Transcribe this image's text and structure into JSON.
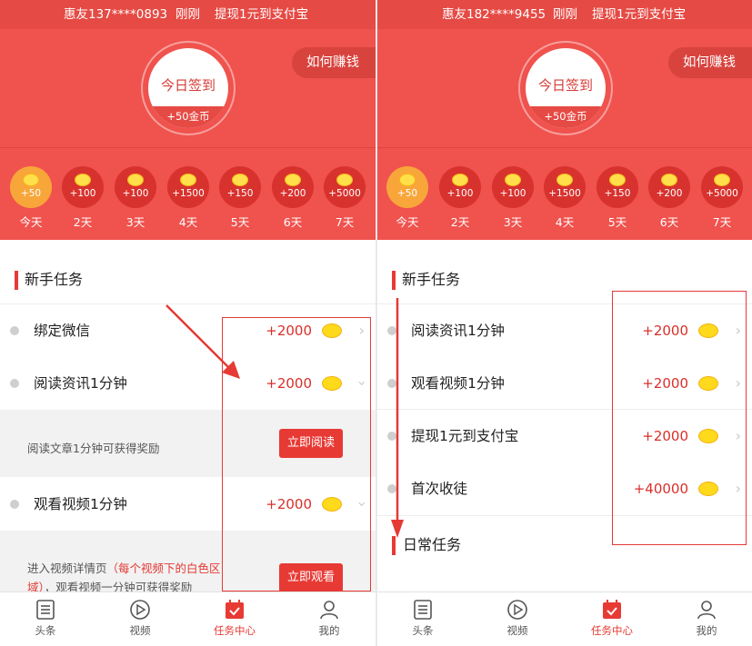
{
  "left": {
    "banner": {
      "user": "惠友137****0893",
      "time": "刚刚",
      "message": "提现1元到支付宝"
    },
    "checkin": {
      "title": "今日签到",
      "reward": "+50金币"
    },
    "earn_button": "如何赚钱",
    "days": [
      {
        "amount": "+50",
        "label": "今天"
      },
      {
        "amount": "+100",
        "label": "2天"
      },
      {
        "amount": "+100",
        "label": "3天"
      },
      {
        "amount": "+1500",
        "label": "4天"
      },
      {
        "amount": "+150",
        "label": "5天"
      },
      {
        "amount": "+200",
        "label": "6天"
      },
      {
        "amount": "+5000",
        "label": "7天"
      }
    ],
    "section_title": "新手任务",
    "tasks": [
      {
        "name": "绑定微信",
        "reward": "+2000"
      },
      {
        "name": "阅读资讯1分钟",
        "reward": "+2000"
      },
      {
        "name": "观看视频1分钟",
        "reward": "+2000"
      }
    ],
    "read_detail": {
      "text": "阅读文章1分钟可获得奖励",
      "button": "立即阅读"
    },
    "video_detail": {
      "line1_prefix": "进入视频详情页",
      "line1_highlight": "（每个视频下的白色区",
      "line2_highlight": "域）",
      "line2_suffix": "，观看视频一分钟可获得奖励",
      "button": "立即观看"
    }
  },
  "right": {
    "banner": {
      "user": "惠友182****9455",
      "time": "刚刚",
      "message": "提现1元到支付宝"
    },
    "checkin": {
      "title": "今日签到",
      "reward": "+50金币"
    },
    "earn_button": "如何赚钱",
    "days": [
      {
        "amount": "+50",
        "label": "今天"
      },
      {
        "amount": "+100",
        "label": "2天"
      },
      {
        "amount": "+100",
        "label": "3天"
      },
      {
        "amount": "+1500",
        "label": "4天"
      },
      {
        "amount": "+150",
        "label": "5天"
      },
      {
        "amount": "+200",
        "label": "6天"
      },
      {
        "amount": "+5000",
        "label": "7天"
      }
    ],
    "section_title": "新手任务",
    "tasks": [
      {
        "name": "阅读资讯1分钟",
        "reward": "+2000"
      },
      {
        "name": "观看视频1分钟",
        "reward": "+2000"
      },
      {
        "name": "提现1元到支付宝",
        "reward": "+2000"
      },
      {
        "name": "首次收徒",
        "reward": "+40000"
      }
    ],
    "daily_title": "日常任务"
  },
  "tabbar": [
    {
      "label": "头条",
      "icon": "news-icon"
    },
    {
      "label": "视频",
      "icon": "video-play-icon"
    },
    {
      "label": "任务中心",
      "icon": "calendar-check-icon"
    },
    {
      "label": "我的",
      "icon": "user-icon"
    }
  ],
  "colors": {
    "primary_red": "#f0524d",
    "accent_red": "#e83a34",
    "gold": "#ffd91c",
    "today_orange": "#f8a63a"
  }
}
